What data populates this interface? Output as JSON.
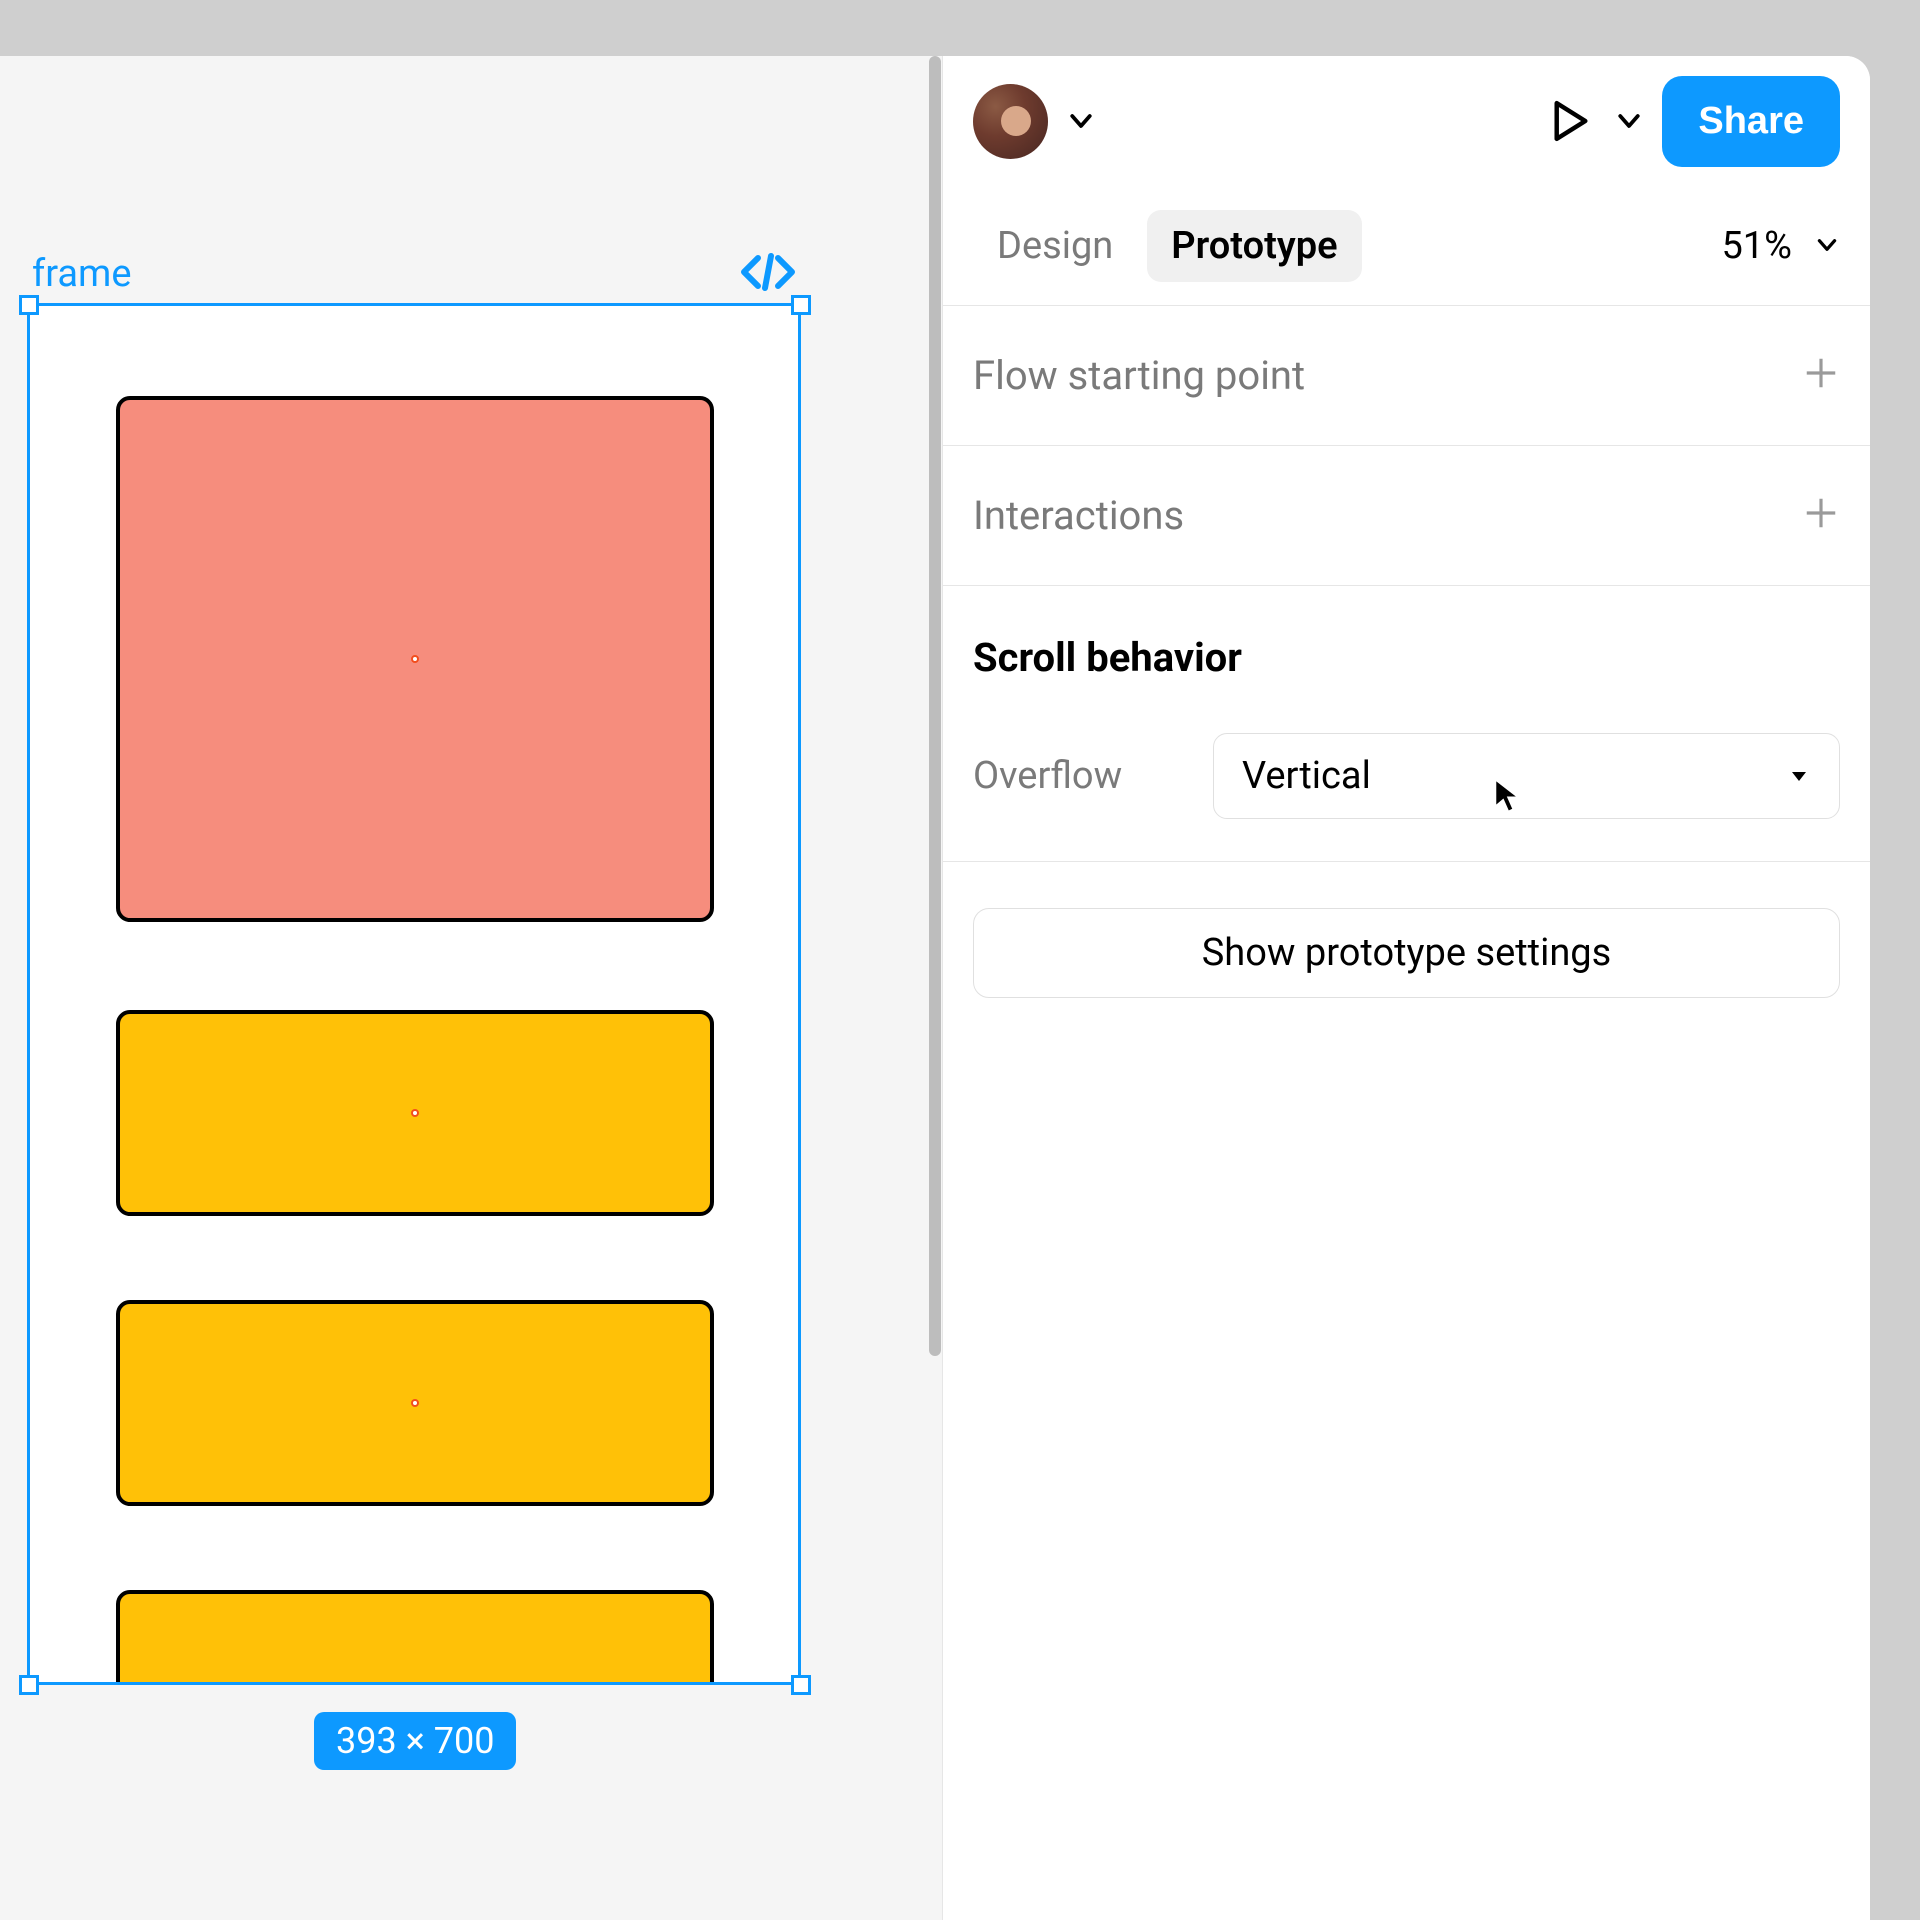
{
  "canvas": {
    "frame_label": "frame",
    "size_label": "393 × 700",
    "colors": {
      "pink": "#F68D7D",
      "yellow": "#FFC107",
      "selection": "#0d99ff"
    }
  },
  "header": {
    "share_label": "Share"
  },
  "tabs": {
    "design_label": "Design",
    "prototype_label": "Prototype",
    "zoom_label": "51%"
  },
  "sections": {
    "flow_label": "Flow starting point",
    "interactions_label": "Interactions"
  },
  "scroll": {
    "title": "Scroll behavior",
    "overflow_label": "Overflow",
    "overflow_value": "Vertical"
  },
  "footer": {
    "show_settings_label": "Show prototype settings"
  }
}
